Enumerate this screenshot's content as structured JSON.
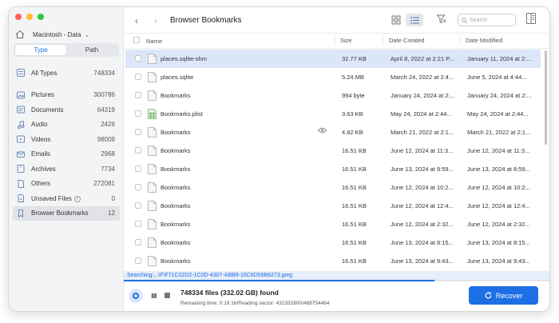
{
  "window": {
    "title": "Browser Bookmarks",
    "traffic_colors": [
      "#ff5f57",
      "#febc2e",
      "#28c840"
    ]
  },
  "sidebar": {
    "drive": "Macintosh - Data",
    "tabs": [
      {
        "label": "Type",
        "active": true
      },
      {
        "label": "Path",
        "active": false
      }
    ],
    "items": [
      {
        "icon": "all-types-icon",
        "label": "All Types",
        "count": "748334"
      },
      {
        "icon": "pictures-icon",
        "label": "Pictures",
        "count": "300786"
      },
      {
        "icon": "documents-icon",
        "label": "Documents",
        "count": "64319"
      },
      {
        "icon": "audio-icon",
        "label": "Audio",
        "count": "2426"
      },
      {
        "icon": "videos-icon",
        "label": "Videos",
        "count": "98009"
      },
      {
        "icon": "emails-icon",
        "label": "Emails",
        "count": "2968"
      },
      {
        "icon": "archives-icon",
        "label": "Archives",
        "count": "7734"
      },
      {
        "icon": "others-icon",
        "label": "Others",
        "count": "272081"
      },
      {
        "icon": "unsaved-files-icon",
        "label": "Unsaved Files",
        "count": "0"
      },
      {
        "icon": "bookmark-icon",
        "label": "Browser Bookmarks",
        "count": "12",
        "selected": true
      }
    ]
  },
  "toolbar": {
    "search_placeholder": "Search"
  },
  "table": {
    "columns": [
      "Name",
      "Size",
      "Date Created",
      "Date Modified"
    ],
    "rows": [
      {
        "name": "places.sqlite-shm",
        "size": "32.77 KB",
        "created": "April 8, 2022 at 2:21 P...",
        "modified": "January 11, 2024 at 2:...",
        "icon": "doc",
        "selected": true
      },
      {
        "name": "places.sqlite",
        "size": "5.24 MB",
        "created": "March 24, 2022 at 2:4...",
        "modified": "June 5, 2024 at 4:44...",
        "icon": "doc"
      },
      {
        "name": "Bookmarks",
        "size": "994 byte",
        "created": "January 24, 2024 at 2:...",
        "modified": "January 24, 2024 at 2:...",
        "icon": "doc"
      },
      {
        "name": "Bookmarks.plist",
        "size": "3.63 KB",
        "created": "May 24, 2024 at 2:44...",
        "modified": "May 24, 2024 at 2:44...",
        "icon": "plist"
      },
      {
        "name": "Bookmarks",
        "size": "4.82 KB",
        "created": "March 21, 2022 at 2:1...",
        "modified": "March 21, 2022 at 2:1...",
        "icon": "doc",
        "preview": true
      },
      {
        "name": "Bookmarks",
        "size": "16.51 KB",
        "created": "June 12, 2024 at 11:3...",
        "modified": "June 12, 2024 at 11:3...",
        "icon": "doc"
      },
      {
        "name": "Bookmarks",
        "size": "16.51 KB",
        "created": "June 13, 2024 at 8:59...",
        "modified": "June 13, 2024 at 8:59...",
        "icon": "doc"
      },
      {
        "name": "Bookmarks",
        "size": "16.51 KB",
        "created": "June 12, 2024 at 10:2...",
        "modified": "June 12, 2024 at 10:2...",
        "icon": "doc"
      },
      {
        "name": "Bookmarks",
        "size": "16.51 KB",
        "created": "June 12, 2024 at 12:4...",
        "modified": "June 12, 2024 at 12:4...",
        "icon": "doc"
      },
      {
        "name": "Bookmarks",
        "size": "16.51 KB",
        "created": "June 12, 2024 at 2:32...",
        "modified": "June 12, 2024 at 2:32...",
        "icon": "doc"
      },
      {
        "name": "Bookmarks",
        "size": "16.51 KB",
        "created": "June 13, 2024 at 8:15...",
        "modified": "June 13, 2024 at 8:15...",
        "icon": "doc"
      },
      {
        "name": "Bookmarks",
        "size": "16.51 KB",
        "created": "June 13, 2024 at 9:43...",
        "modified": "June 13, 2024 at 9:43...",
        "icon": "doc"
      }
    ]
  },
  "status": {
    "searching": "Searching:...\\F\\F71C02D2-1C0D-4307-ABB9-15C6D56B6273.jpeg",
    "progress": 0.73,
    "found": "748334 files (332.02 GB) found",
    "remaining": "Remaining time: 0:19:16/Reading sector: 432332800/488754464"
  },
  "recover_label": "Recover",
  "colors": {
    "accent": "#1d6fe5",
    "selection": "#dbe7f9"
  }
}
